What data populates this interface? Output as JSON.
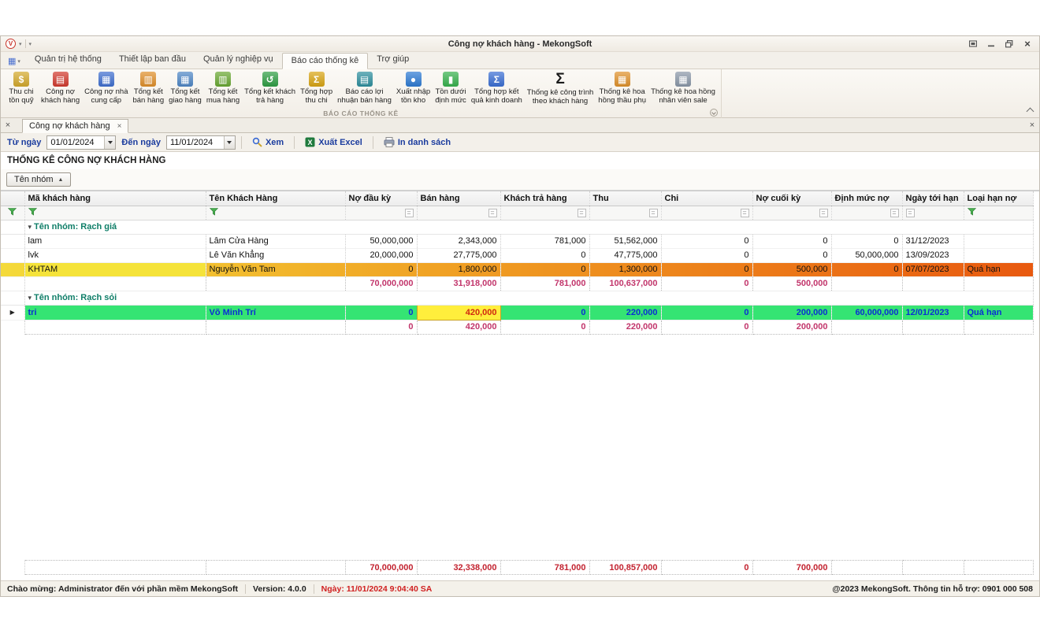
{
  "colors": {
    "accent_blue": "#1b3c9e",
    "group_teal": "#0f7e68",
    "total_magenta": "#c2356b",
    "grand_total_red": "#c32330",
    "overdue_yellow": "#f4da3a",
    "overdue_orange": "#e8590f",
    "selected_green": "#35e473",
    "selected_text_blue": "#0a2fd4",
    "focused_yellow": "#ffee3c",
    "focused_red": "#d02810"
  },
  "window": {
    "title": "Công nợ khách hàng - MekongSoft",
    "logo_letter": "V"
  },
  "ribbon": {
    "tabs": [
      {
        "label": "Quản trị hệ thống",
        "active": false
      },
      {
        "label": "Thiết lập ban đầu",
        "active": false
      },
      {
        "label": "Quản lý nghiệp vụ",
        "active": false
      },
      {
        "label": "Báo cáo thống kê",
        "active": true
      },
      {
        "label": "Trợ giúp",
        "active": false
      }
    ],
    "group_caption": "BÁO CÁO THỐNG KÊ",
    "buttons": [
      {
        "id": "thu-chi-ton-quy",
        "label": "Thu chi\ntồn quỹ",
        "icon": "coins-icon",
        "glyph": "$",
        "color": "#d4a92c"
      },
      {
        "id": "cong-no-khach-hang",
        "label": "Công nợ\nkhách hàng",
        "icon": "customer-debt-icon",
        "glyph": "▤",
        "color": "#d23a2e"
      },
      {
        "id": "cong-no-nha-cung-cap",
        "label": "Công nợ nhà\ncung cấp",
        "icon": "supplier-debt-icon",
        "glyph": "▦",
        "color": "#3f6fd0"
      },
      {
        "id": "tong-ket-ban-hang",
        "label": "Tổng kết\nbán hàng",
        "icon": "sales-summary-icon",
        "glyph": "▥",
        "color": "#e08f2a"
      },
      {
        "id": "tong-ket-giao-hang",
        "label": "Tổng kết\ngiao hàng",
        "icon": "delivery-summary-icon",
        "glyph": "▦",
        "color": "#4f87c6"
      },
      {
        "id": "tong-ket-mua-hang",
        "label": "Tổng kết\nmua hàng",
        "icon": "purchase-summary-icon",
        "glyph": "▥",
        "color": "#69a832"
      },
      {
        "id": "tong-ket-khach-tra-hang",
        "label": "Tổng kết khách\ntrả hàng",
        "icon": "returns-summary-icon",
        "glyph": "↺",
        "color": "#2f9e44"
      },
      {
        "id": "tong-hop-thu-chi",
        "label": "Tổng hợp\nthu chi",
        "icon": "income-expense-icon",
        "glyph": "Σ",
        "color": "#d9a514"
      },
      {
        "id": "bao-cao-loi-nhuan-ban-hang",
        "label": "Báo cáo lợi\nnhuận bán hàng",
        "icon": "profit-report-icon",
        "glyph": "▤",
        "color": "#2e8f9e"
      },
      {
        "id": "xuat-nhap-ton-kho",
        "label": "Xuất nhập\ntồn kho",
        "icon": "inventory-icon",
        "glyph": "●",
        "color": "#2e7bd4"
      },
      {
        "id": "ton-duoi-dinh-muc",
        "label": "Tồn dưới\nđịnh mức",
        "icon": "low-stock-icon",
        "glyph": "▮",
        "color": "#37b24d"
      },
      {
        "id": "tong-hop-ket-qua-kinh-doanh",
        "label": "Tổng hợp kết\nquả kinh doanh",
        "icon": "business-result-icon",
        "glyph": "Σ",
        "color": "#3b6fd4"
      },
      {
        "id": "thong-ke-cong-trinh-theo-khach-hang",
        "label": "Thống kê công trình\ntheo khách hàng",
        "icon": "sigma-icon",
        "glyph": "Σ",
        "color": "#1a1a1a",
        "plain": true
      },
      {
        "id": "thong-ke-hoa-hong-thau-phu",
        "label": "Thống kê hoa\nhồng thầu phụ",
        "icon": "subcontractor-commission-icon",
        "glyph": "▦",
        "color": "#e0912a"
      },
      {
        "id": "thong-ke-hoa-hong-nhan-vien-sale",
        "label": "Thống kê hoa hồng\nnhân viên sale",
        "icon": "sales-commission-icon",
        "glyph": "▦",
        "color": "#8a97a8"
      }
    ]
  },
  "doc_tab": {
    "label": "Công nợ khách hàng"
  },
  "filter_bar": {
    "from_label": "Từ ngày",
    "from_value": "01/01/2024",
    "to_label": "Đến ngày",
    "to_value": "11/01/2024",
    "view_label": "Xem",
    "excel_label": "Xuất Excel",
    "print_label": "In danh sách"
  },
  "report": {
    "title": "THỐNG KÊ CÔNG NỢ KHÁCH HÀNG",
    "group_chip": "Tên nhóm"
  },
  "grid": {
    "columns": [
      "Mã khách hàng",
      "Tên Khách Hàng",
      "Nợ đầu kỳ",
      "Bán hàng",
      "Khách trả hàng",
      "Thu",
      "Chi",
      "Nợ cuối kỳ",
      "Định mức nợ",
      "Ngày tới hạn",
      "Loại hạn nợ"
    ],
    "groups": [
      {
        "name": "Tên nhóm: Rạch giá",
        "rows": [
          {
            "code": "lam",
            "name": "Lâm Cửa Hàng",
            "no_dau_ky": "50,000,000",
            "ban_hang": "2,343,000",
            "khach_tra_hang": "781,000",
            "thu": "51,562,000",
            "chi": "0",
            "no_cuoi_ky": "0",
            "dinh_muc_no": "0",
            "ngay_toi_han": "31/12/2023",
            "loai_han_no": "",
            "style": "normal"
          },
          {
            "code": "lvk",
            "name": "Lê Văn Khẳng",
            "no_dau_ky": "20,000,000",
            "ban_hang": "27,775,000",
            "khach_tra_hang": "0",
            "thu": "47,775,000",
            "chi": "0",
            "no_cuoi_ky": "0",
            "dinh_muc_no": "50,000,000",
            "ngay_toi_han": "13/09/2023",
            "loai_han_no": "",
            "style": "normal"
          },
          {
            "code": "KHTAM",
            "name": "Nguyễn Văn Tam",
            "no_dau_ky": "0",
            "ban_hang": "1,800,000",
            "khach_tra_hang": "0",
            "thu": "1,300,000",
            "chi": "0",
            "no_cuoi_ky": "500,000",
            "dinh_muc_no": "0",
            "ngay_toi_han": "07/07/2023",
            "loai_han_no": "Quá hạn",
            "style": "overdue"
          }
        ],
        "totals": {
          "no_dau_ky": "70,000,000",
          "ban_hang": "31,918,000",
          "khach_tra_hang": "781,000",
          "thu": "100,637,000",
          "chi": "0",
          "no_cuoi_ky": "500,000"
        }
      },
      {
        "name": "Tên nhóm: Rạch sỏi",
        "rows": [
          {
            "code": "tri",
            "name": "Võ Minh Trí",
            "no_dau_ky": "0",
            "ban_hang": "420,000",
            "khach_tra_hang": "0",
            "thu": "220,000",
            "chi": "0",
            "no_cuoi_ky": "200,000",
            "dinh_muc_no": "60,000,000",
            "ngay_toi_han": "12/01/2023",
            "loai_han_no": "Quá hạn",
            "style": "selected",
            "focused_col": "ban_hang"
          }
        ],
        "totals": {
          "no_dau_ky": "0",
          "ban_hang": "420,000",
          "khach_tra_hang": "0",
          "thu": "220,000",
          "chi": "0",
          "no_cuoi_ky": "200,000"
        }
      }
    ],
    "grand_totals": {
      "no_dau_ky": "70,000,000",
      "ban_hang": "32,338,000",
      "khach_tra_hang": "781,000",
      "thu": "100,857,000",
      "chi": "0",
      "no_cuoi_ky": "700,000"
    }
  },
  "status_bar": {
    "welcome": "Chào mừng: Administrator đến với phần mềm MekongSoft",
    "version_label": "Version: 4.0.0",
    "date_label": "Ngày: 11/01/2024 9:04:40 SA",
    "right": "@2023 MekongSoft. Thông tin hỗ trợ: 0901 000 508"
  }
}
